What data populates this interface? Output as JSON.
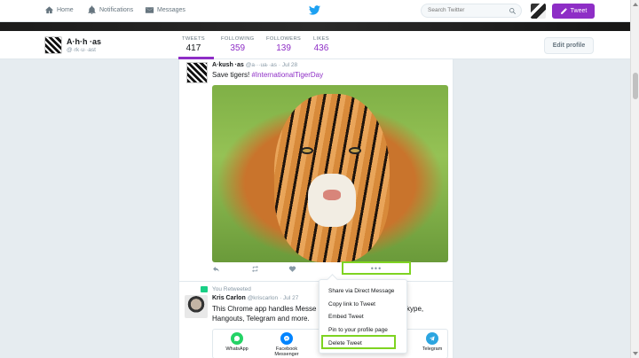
{
  "nav": {
    "home": "Home",
    "notifications": "Notifications",
    "messages": "Messages",
    "search_placeholder": "Search Twitter",
    "tweet_button": "Tweet"
  },
  "profile": {
    "name": "A·h·h ·as",
    "handle": "@·rk·u··ast",
    "stats": [
      {
        "label": "TWEETS",
        "value": "417"
      },
      {
        "label": "FOLLOWING",
        "value": "359"
      },
      {
        "label": "FOLLOWERS",
        "value": "139"
      },
      {
        "label": "LIKES",
        "value": "436"
      }
    ],
    "edit_profile": "Edit profile"
  },
  "tweet": {
    "name": "A·kush ·as",
    "handle": "@a···ua··as",
    "date": "· Jul 28",
    "text": "Save tigers! ",
    "hashtag": "#InternationalTigerDay",
    "more": "•••"
  },
  "retweet": {
    "label": "You Retweeted",
    "name": "Kris Carlon",
    "handle": "@kriscarlon",
    "date": "· Jul 27",
    "text_line1": "This Chrome app handles Messe",
    "text_line1_end": "kype,",
    "text_line2": "Hangouts, Telegram and more."
  },
  "share_card": {
    "items": [
      {
        "label": "WhatsApp",
        "color": "#25d366"
      },
      {
        "label": "Facebook Messenger",
        "color": "#0084ff"
      },
      {
        "label": "Telegram",
        "color": "#2ca5e0"
      }
    ]
  },
  "dropdown": {
    "items": [
      "Share via Direct Message",
      "Copy link to Tweet",
      "Embed Tweet",
      "Pin to your profile page",
      "Delete Tweet"
    ]
  },
  "colors": {
    "accent": "#8e2ec6",
    "highlight": "#7ed321",
    "twitter_blue": "#1da1f2"
  }
}
